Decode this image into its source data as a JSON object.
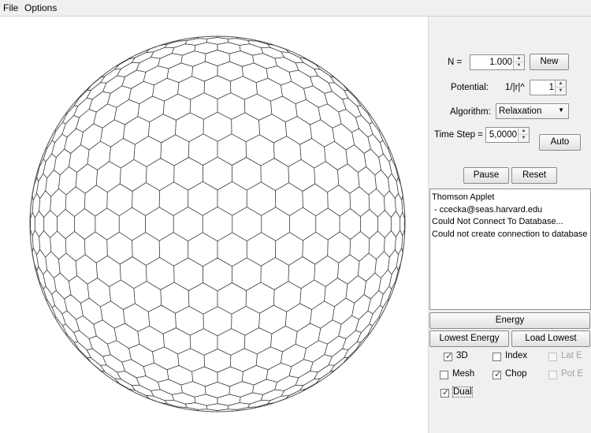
{
  "menu": {
    "file": "File",
    "options": "Options"
  },
  "controls": {
    "n_label": "N =",
    "n_value": "1.000",
    "new_label": "New",
    "potential_label": "Potential:",
    "potential_formula": "1/|r|^",
    "potential_exponent": "1",
    "algorithm_label": "Algorithm:",
    "algorithm_value": "Relaxation",
    "timestep_label": "Time Step =",
    "timestep_value": "5,0000",
    "auto_label": "Auto",
    "pause_label": "Pause",
    "reset_label": "Reset"
  },
  "console": {
    "lines": [
      "Thomson Applet",
      " - ccecka@seas.harvard.edu",
      "Could Not Connect To Database...",
      "Could not create connection to database s"
    ]
  },
  "buttons": {
    "energy": "Energy",
    "lowest_energy": "Lowest Energy",
    "load_lowest": "Load Lowest"
  },
  "checkboxes": {
    "three_d": {
      "label": "3D",
      "checked": true,
      "enabled": true
    },
    "index": {
      "label": "Index",
      "checked": false,
      "enabled": true
    },
    "lat_e": {
      "label": "Lat E",
      "checked": false,
      "enabled": false
    },
    "mesh": {
      "label": "Mesh",
      "checked": false,
      "enabled": true
    },
    "chop": {
      "label": "Chop",
      "checked": true,
      "enabled": true
    },
    "pot_e": {
      "label": "Pot E",
      "checked": false,
      "enabled": false
    },
    "dual": {
      "label": "Dual",
      "checked": true,
      "enabled": true
    }
  },
  "colors": {
    "panel_bg": "#f0f0f0",
    "mesh_stroke": "#2a2a2a",
    "disabled_text": "#a0a0a0"
  },
  "icons": {
    "spinner_up": "triangle-up",
    "spinner_down": "triangle-down",
    "select_arrow": "triangle-down",
    "check": "check-mark"
  }
}
